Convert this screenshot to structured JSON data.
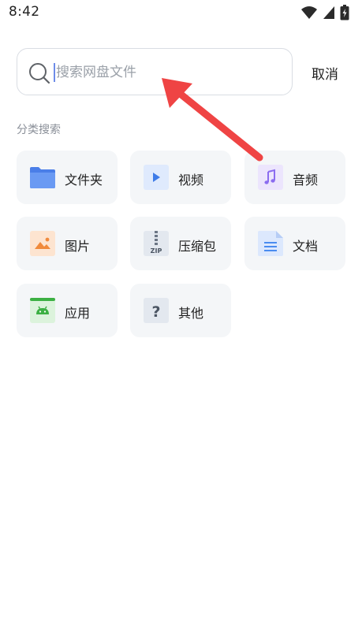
{
  "status_bar": {
    "time": "8:42",
    "icons": [
      "wifi-icon",
      "signal-icon",
      "battery-charging-icon"
    ]
  },
  "search": {
    "placeholder": "搜索网盘文件",
    "value": "",
    "cancel_label": "取消",
    "icon": "search-icon"
  },
  "categories": {
    "title": "分类搜索",
    "items": [
      {
        "label": "文件夹",
        "icon": "folder-icon"
      },
      {
        "label": "视频",
        "icon": "video-icon"
      },
      {
        "label": "音频",
        "icon": "music-icon"
      },
      {
        "label": "图片",
        "icon": "image-icon"
      },
      {
        "label": "压缩包",
        "icon": "zip-icon"
      },
      {
        "label": "文档",
        "icon": "document-icon"
      },
      {
        "label": "应用",
        "icon": "android-app-icon"
      },
      {
        "label": "其他",
        "icon": "other-icon"
      }
    ]
  },
  "colors": {
    "accent": "#ef4444",
    "tile_bg": "#f4f6f8",
    "folder": "#5b8def",
    "music": "#8b6cf0",
    "image": "#f08a3c",
    "document": "#4a8cf0",
    "android": "#3cb043"
  }
}
